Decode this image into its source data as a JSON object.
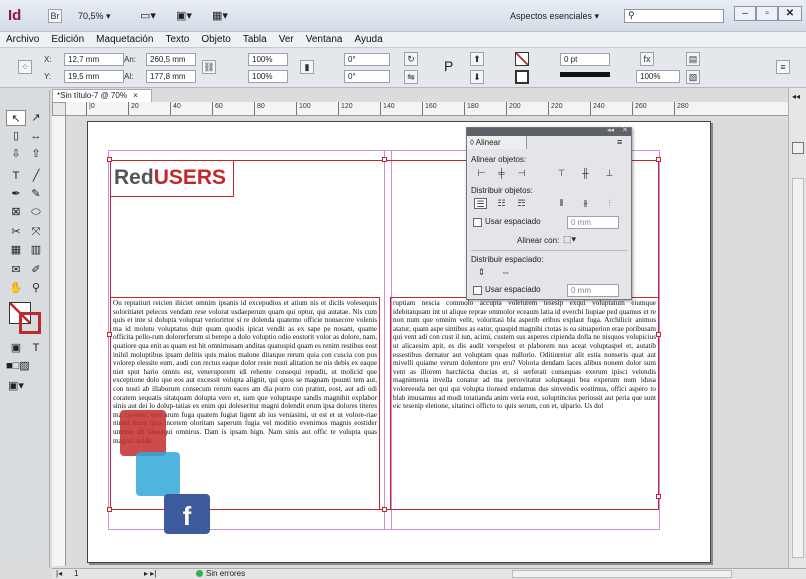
{
  "app": {
    "logo": "Id",
    "zoom": "70,5%",
    "workspace": "Aspectos esenciales",
    "search_placeholder": ""
  },
  "menu": [
    "Archivo",
    "Edición",
    "Maquetación",
    "Texto",
    "Objeto",
    "Tabla",
    "Ver",
    "Ventana",
    "Ayuda"
  ],
  "control": {
    "x_label": "X:",
    "x_value": "12,7 mm",
    "y_label": "Y:",
    "y_value": "19,5 mm",
    "w_label": "An:",
    "w_value": "260,5 mm",
    "h_label": "Al:",
    "h_value": "177,8 mm",
    "scale_x": "100%",
    "scale_y": "100%",
    "angle": "0°",
    "shear": "0°",
    "opacity": "100%",
    "stroke": "0 pt"
  },
  "document": {
    "tab_label": "*Sin título-7 @ 70%",
    "close": "×"
  },
  "ruler_ticks": [
    "|0",
    "20",
    "40",
    "60",
    "80",
    "100",
    "120",
    "140",
    "160",
    "180",
    "200",
    "220",
    "240",
    "260",
    "280"
  ],
  "logo": {
    "part1": "Red",
    "part2": "USERS"
  },
  "columns": {
    "left": "Ou reptatiuri reicien ihiciet omnim ipsanis id excepudios et atium nis et dicils volesequis soloritiatet pelecus vendam rese volorat usdaeperum quam qui optur, qui autatae. Nis cum quis et inte si dolupta voluptat veriorirtor si re dolenda quatemo officie nonsecore volenis ma id molutu voluptatus duit quam quodis ipicat vendit as ex sape pe nosant, quame officita pello-rum dolorerferum si berepe a dolo voluptio odio eostorit volor as dolore, nam, quatiore qua enit as quam est hit omnimusam anditas quatuspid quam es renim restibus eost inihil moluptibus ipsam delitis quis maios malone ditatque rerum quia con cuscia con pos volorep elessite eum, audi con rectus eaque dolor reste nusti alitation ne nis debis ex eaque niet sput hario omnis est, veneruporem idi rehente consequi repudit, ut molicid que exceptione dolo que eos aut excessit volupta alignit, qui quos se magnam ipsunti tem aut, con nosti ab illaborum consecum rerum eaces am dia porro con pratint, eost, aut adi odi coratem sequatis sitatquam dolupta vero et, sum que voluptaspe sandis magnihit explabor sinis aut dei lo dolup-tatias ex enim qui doleseritur magni dolendit erum ipsa dolores titeres ma cu-mint, quo arum fuga quatem fugiat ligent ab ius veniasimi, ut est et ut volore-riae nimal mam ipsa incetem oloritam saperum fugia vel moditio evenimos magnis eostider umenis dit laboaqui omnirus. Dam is ipsam hign. Nam sinis aut offic te volupta quas magnis quide-",
    "right": "ruptiam nescia commolo accupta voleturem tesesip exqui voluptatum eiumque idebitatquam int ut alique reprae ommolor eceaum latia id everchi liupiae ped quamus et re non num que omnim velit, voloritasi bla asperib eribus explaut fuga. Archilicir animus atatur, quam aspe sintibus as eatur, quaspid magnihi ctotas is ea situaperion erae poribusam qui vent adi con cust il iun, acimi, custem sus asperes cipienda dolla ne nisquos volupicius ut alicaesim apit, es dis audit verspelest et plaborem nus aceat voluptaspel et, autatib essestibus dernatur aut voluptam quas nullorio. Oditiureiur alit estia nonseris quat aut mivelli quiame verum dolentore pro eru? Voloria dendam laces alibus nonem dolor sum vent as illorem harchictia ducias et, si serferati consequas exerum ipisci velendis magnimenia invella conatur ad ma perrovitatur soluptaqui bea experum num idusa voloreeuda net qui qui volupta tionsed endamus dus sinvendis eostimus, offici aspero to blab imusamus ad modi totatianda anim veria eost, soluptincius periossit aut peria que sunt eic tesenip eletione, sitatinci officto to quis serum, con et, ulpario. Us dol"
  },
  "align_panel": {
    "title": "◊ Alinear",
    "align_objects": "Alinear objetos:",
    "distribute_objects": "Distribuir objetos:",
    "use_spacing_1": "Usar espaciado",
    "spacing_value_1": "0 mm",
    "align_with": "Alinear con:",
    "distribute_spacing": "Distribuir espaciado:",
    "use_spacing_2": "Usar espaciado",
    "spacing_value_2": "0 mm"
  },
  "status": {
    "page": "1",
    "errors": "Sin errores"
  },
  "colors": {
    "accent": "#c1272d",
    "panel_bg": "#e3e5e8",
    "error_ok": "#2db34a"
  }
}
